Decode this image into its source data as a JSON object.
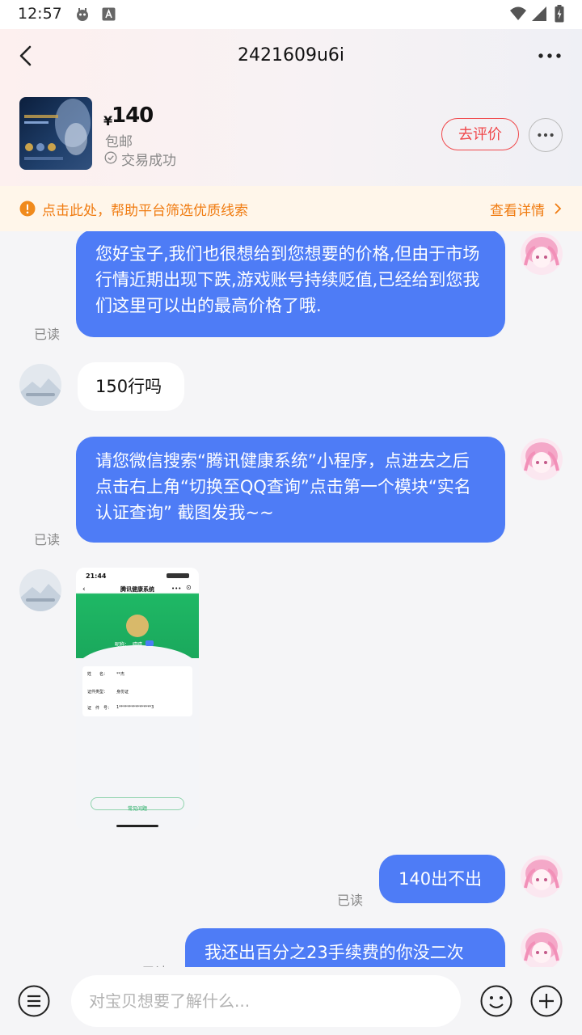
{
  "status": {
    "time": "12:57"
  },
  "header": {
    "title": "2421609u6i",
    "price_symbol": "¥",
    "price": "140",
    "shipping": "包邮",
    "deal_status": "交易成功",
    "review_label": "去评价"
  },
  "notice": {
    "text": "点击此处，帮助平台筛选优质线索",
    "link": "查看详情"
  },
  "messages": [
    {
      "text": "您好宝子,我们也很想给到您想要的价格,但由于市场行情近期出现下跌,游戏账号持续贬值,已经给到您我们这里可以出的最高价格了哦.",
      "read": "已读"
    },
    {
      "text": "150行吗"
    },
    {
      "text": "请您微信搜索“腾讯健康系统”小程序，点进去之后点击右上角“切换至QQ查询”点击第一个模块“实名认证查询” 截图发我~~",
      "read": "已读"
    },
    {
      "text": "140出不出",
      "read": "已读"
    },
    {
      "text": "我还出百分之23手续费的你没二次",
      "read": "已读"
    }
  ],
  "screenshot": {
    "time": "21:44",
    "title": "腾讯健康系统",
    "nick_label": "昵称：",
    "nick": "嘻嘻",
    "rows": [
      {
        "label": "姓　　名：",
        "value": "**杰"
      },
      {
        "label": "证件类型：",
        "value": "身份证"
      },
      {
        "label": "证　件　号：",
        "value": "1****************3"
      }
    ],
    "button": "常见问题"
  },
  "input": {
    "placeholder": "对宝贝想要了解什么..."
  }
}
